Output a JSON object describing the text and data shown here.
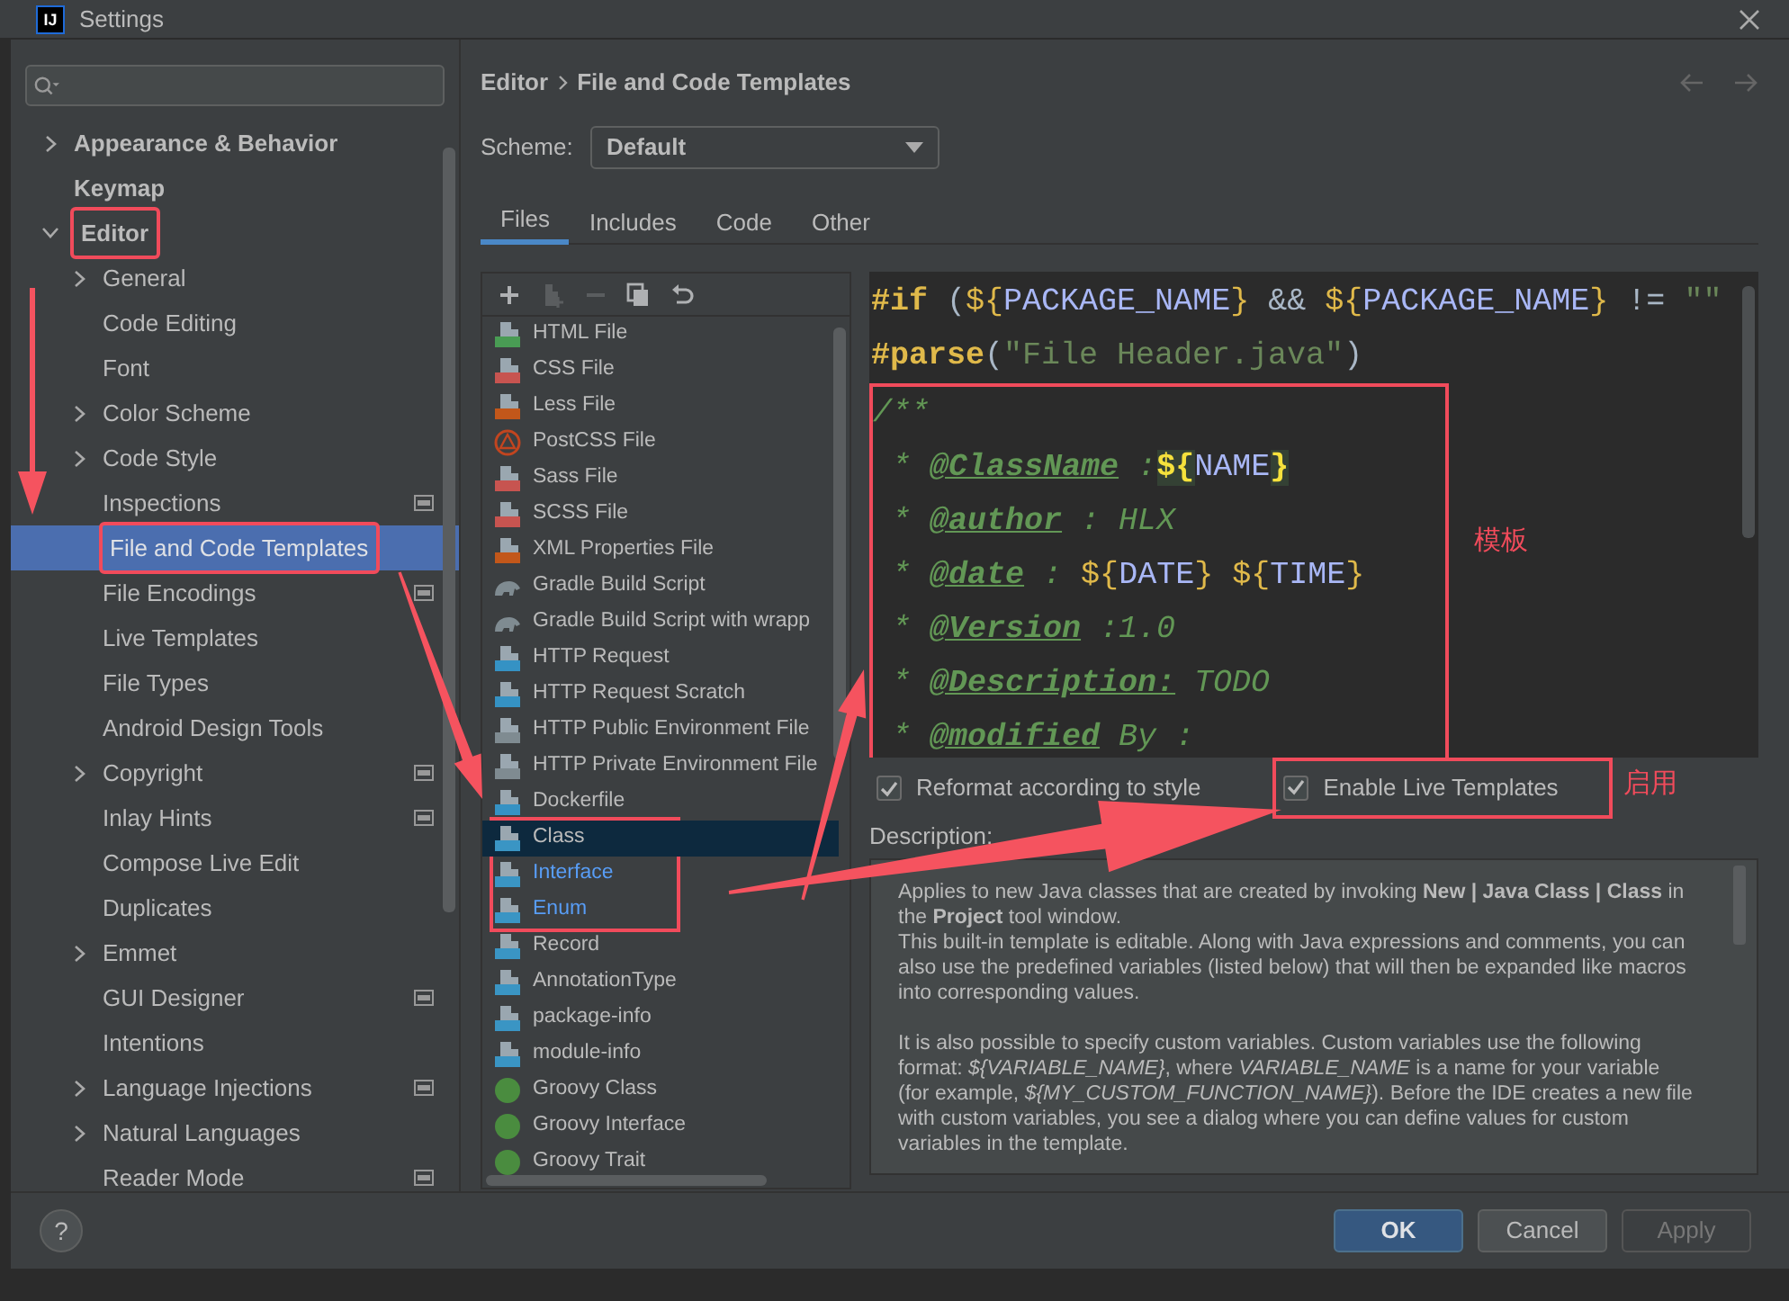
{
  "window": {
    "logo": "IJ",
    "title": "Settings"
  },
  "sidebar": {
    "items": [
      {
        "label": "Appearance & Behavior",
        "expanded": false
      },
      {
        "label": "Keymap"
      },
      {
        "label": "Editor",
        "expanded": true,
        "annotated": true,
        "children": [
          {
            "label": "General",
            "expanded": false
          },
          {
            "label": "Code Editing"
          },
          {
            "label": "Font"
          },
          {
            "label": "Color Scheme",
            "expanded": false
          },
          {
            "label": "Code Style",
            "expanded": false
          },
          {
            "label": "Inspections",
            "project_level": true
          },
          {
            "label": "File and Code Templates",
            "selected": true,
            "annotated": true
          },
          {
            "label": "File Encodings",
            "project_level": true
          },
          {
            "label": "Live Templates"
          },
          {
            "label": "File Types"
          },
          {
            "label": "Android Design Tools"
          },
          {
            "label": "Copyright",
            "expanded": false,
            "project_level": true
          },
          {
            "label": "Inlay Hints",
            "project_level": true
          },
          {
            "label": "Compose Live Edit"
          },
          {
            "label": "Duplicates"
          },
          {
            "label": "Emmet",
            "expanded": false
          },
          {
            "label": "GUI Designer",
            "project_level": true
          },
          {
            "label": "Intentions"
          },
          {
            "label": "Language Injections",
            "expanded": false,
            "project_level": true
          },
          {
            "label": "Natural Languages",
            "expanded": false
          },
          {
            "label": "Reader Mode",
            "project_level": true
          }
        ]
      }
    ]
  },
  "breadcrumb": [
    "Editor",
    "File and Code Templates"
  ],
  "scheme": {
    "label": "Scheme:",
    "value": "Default"
  },
  "tabs": [
    {
      "label": "Files",
      "selected": true
    },
    {
      "label": "Includes",
      "selected": false
    },
    {
      "label": "Code",
      "selected": false
    },
    {
      "label": "Other",
      "selected": false
    }
  ],
  "toolbar": [
    {
      "kind": "add",
      "disabled": false
    },
    {
      "kind": "add-child",
      "disabled": true
    },
    {
      "kind": "remove",
      "disabled": true
    },
    {
      "kind": "copy",
      "disabled": false
    },
    {
      "kind": "reset",
      "disabled": false
    }
  ],
  "files": [
    {
      "label": "HTML File",
      "kind": "file",
      "color": "#499c54",
      "selected": false,
      "modified": false,
      "annotated": false
    },
    {
      "label": "CSS File",
      "kind": "file",
      "color": "#c75450",
      "selected": false,
      "modified": false,
      "annotated": false
    },
    {
      "label": "Less File",
      "kind": "file",
      "color": "#c2571a",
      "selected": false,
      "modified": false,
      "annotated": false
    },
    {
      "label": "PostCSS File",
      "kind": "postcss",
      "color": "#c2451f",
      "selected": false,
      "modified": false,
      "annotated": false
    },
    {
      "label": "Sass File",
      "kind": "file",
      "color": "#c75450",
      "selected": false,
      "modified": false,
      "annotated": false
    },
    {
      "label": "SCSS File",
      "kind": "file",
      "color": "#c75450",
      "selected": false,
      "modified": false,
      "annotated": false
    },
    {
      "label": "XML Properties File",
      "kind": "file",
      "color": "#c2571a",
      "selected": false,
      "modified": false,
      "annotated": false
    },
    {
      "label": "Gradle Build Script",
      "kind": "gradle",
      "color": "#7f8b91",
      "selected": false,
      "modified": false,
      "annotated": false
    },
    {
      "label": "Gradle Build Script with wrapp",
      "kind": "gradle",
      "color": "#7f8b91",
      "selected": false,
      "modified": false,
      "annotated": false
    },
    {
      "label": "HTTP Request",
      "kind": "file",
      "color": "#3592c4",
      "selected": false,
      "modified": false,
      "annotated": false
    },
    {
      "label": "HTTP Request Scratch",
      "kind": "file",
      "color": "#3592c4",
      "selected": false,
      "modified": false,
      "annotated": false
    },
    {
      "label": "HTTP Public Environment File",
      "kind": "file",
      "color": "#7f8b91",
      "selected": false,
      "modified": false,
      "annotated": false
    },
    {
      "label": "HTTP Private Environment File",
      "kind": "file",
      "color": "#7f8b91",
      "selected": false,
      "modified": false,
      "annotated": false
    },
    {
      "label": "Dockerfile",
      "kind": "file",
      "color": "#3592c4",
      "selected": false,
      "modified": false,
      "annotated": false
    },
    {
      "label": "Class",
      "kind": "file",
      "color": "#3a95c4",
      "selected": true,
      "modified": false,
      "annotated": true
    },
    {
      "label": "Interface",
      "kind": "file",
      "color": "#3a95c4",
      "selected": false,
      "modified": true,
      "annotated": true
    },
    {
      "label": "Enum",
      "kind": "file",
      "color": "#3a95c4",
      "selected": false,
      "modified": true,
      "annotated": true
    },
    {
      "label": "Record",
      "kind": "file",
      "color": "#3a95c4",
      "selected": false,
      "modified": false,
      "annotated": false
    },
    {
      "label": "AnnotationType",
      "kind": "file",
      "color": "#3a95c4",
      "selected": false,
      "modified": false,
      "annotated": false
    },
    {
      "label": "package-info",
      "kind": "file",
      "color": "#3a95c4",
      "selected": false,
      "modified": false,
      "annotated": false
    },
    {
      "label": "module-info",
      "kind": "file",
      "color": "#3a95c4",
      "selected": false,
      "modified": false,
      "annotated": false
    },
    {
      "label": "Groovy Class",
      "kind": "groovy",
      "color": "#4a8c3f",
      "selected": false,
      "modified": false,
      "annotated": false
    },
    {
      "label": "Groovy Interface",
      "kind": "groovy",
      "color": "#4a8c3f",
      "selected": false,
      "modified": false,
      "annotated": false
    },
    {
      "label": "Groovy Trait",
      "kind": "groovy",
      "color": "#4a8c3f",
      "selected": false,
      "modified": false,
      "annotated": false
    }
  ],
  "editor": {
    "annotation_label": "模板",
    "lines": [
      {
        "annotated": false,
        "segments": [
          {
            "kind": "directive",
            "text": "#if"
          },
          {
            "kind": "punct",
            "text": " ("
          },
          {
            "kind": "brace",
            "text": "${"
          },
          {
            "kind": "var",
            "text": "PACKAGE_NAME"
          },
          {
            "kind": "brace",
            "text": "}"
          },
          {
            "kind": "punct",
            "text": " && "
          },
          {
            "kind": "brace",
            "text": "${"
          },
          {
            "kind": "var",
            "text": "PACKAGE_NAME"
          },
          {
            "kind": "brace",
            "text": "}"
          },
          {
            "kind": "punct",
            "text": " != "
          },
          {
            "kind": "string",
            "text": "\"\""
          }
        ]
      },
      {
        "annotated": false,
        "segments": [
          {
            "kind": "directive",
            "text": "#parse"
          },
          {
            "kind": "punct",
            "text": "("
          },
          {
            "kind": "string",
            "text": "\"File Header.java\""
          },
          {
            "kind": "punct",
            "text": ")"
          }
        ]
      },
      {
        "annotated": true,
        "segments": [
          {
            "kind": "comment",
            "text": "/**"
          }
        ]
      },
      {
        "annotated": true,
        "segments": [
          {
            "kind": "comment",
            "text": " * "
          },
          {
            "kind": "tag",
            "text": "@ClassName"
          },
          {
            "kind": "comment",
            "text": " :"
          },
          {
            "kind": "live-brace",
            "text": "${"
          },
          {
            "kind": "live-var",
            "text": "NAME"
          },
          {
            "kind": "live-brace",
            "text": "}"
          }
        ]
      },
      {
        "annotated": true,
        "segments": [
          {
            "kind": "comment",
            "text": " * "
          },
          {
            "kind": "tag",
            "text": "@author"
          },
          {
            "kind": "comment",
            "text": " : HLX"
          }
        ]
      },
      {
        "annotated": true,
        "segments": [
          {
            "kind": "comment",
            "text": " * "
          },
          {
            "kind": "tag",
            "text": "@date"
          },
          {
            "kind": "comment",
            "text": " : "
          },
          {
            "kind": "brace",
            "text": "${"
          },
          {
            "kind": "var",
            "text": "DATE"
          },
          {
            "kind": "brace",
            "text": "} "
          },
          {
            "kind": "brace",
            "text": "${"
          },
          {
            "kind": "var",
            "text": "TIME"
          },
          {
            "kind": "brace",
            "text": "}"
          }
        ]
      },
      {
        "annotated": true,
        "segments": [
          {
            "kind": "comment",
            "text": " * "
          },
          {
            "kind": "tag",
            "text": "@Version"
          },
          {
            "kind": "comment",
            "text": " :1.0"
          }
        ]
      },
      {
        "annotated": true,
        "segments": [
          {
            "kind": "comment",
            "text": " * "
          },
          {
            "kind": "tag",
            "text": "@Description:"
          },
          {
            "kind": "comment",
            "text": " TODO"
          }
        ]
      },
      {
        "annotated": true,
        "segments": [
          {
            "kind": "comment",
            "text": " * "
          },
          {
            "kind": "tag",
            "text": "@modified"
          },
          {
            "kind": "comment",
            "text": " By :"
          }
        ]
      }
    ]
  },
  "options": [
    {
      "label": "Reformat according to style",
      "checked": true,
      "annotated": false
    },
    {
      "label": "Enable Live Templates",
      "checked": true,
      "annotated": true,
      "annotation_label": "启用"
    }
  ],
  "description": {
    "label": "Description:",
    "blocks": [
      [
        "Applies to new Java classes that are created by invoking **New | Java Class | Class** in the **Project** tool window.",
        "This built-in template is editable. Along with Java expressions and comments, you can also use the predefined variables (listed below) that will then be expanded like macros into corresponding values."
      ],
      [
        "It is also possible to specify custom variables. Custom variables use the following format: *${VARIABLE_NAME}*, where *VARIABLE_NAME* is a name for your variable (for example, *${MY_CUSTOM_FUNCTION_NAME}*). Before the IDE creates a new file with custom variables, you see a dialog where you can define values for custom variables in the template."
      ]
    ]
  },
  "help": "?",
  "buttons": [
    {
      "label": "OK",
      "kind": "primary",
      "disabled": false
    },
    {
      "label": "Cancel",
      "kind": "default",
      "disabled": false
    },
    {
      "label": "Apply",
      "kind": "default",
      "disabled": true
    }
  ]
}
